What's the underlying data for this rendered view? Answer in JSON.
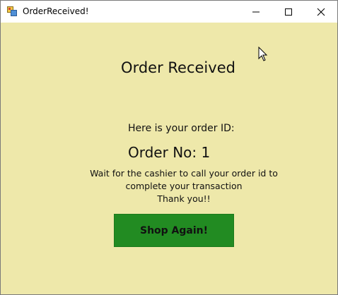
{
  "window": {
    "title": "OrderReceived!",
    "controls": {
      "minimize": "minimize-icon",
      "maximize": "maximize-icon",
      "close": "close-icon"
    }
  },
  "content": {
    "heading": "Order Received",
    "order_id_prompt": "Here is your order ID:",
    "order_label": "Order No:",
    "order_number": "1",
    "wait_line1": "Wait for the cashier to call your order id to",
    "wait_line2": "complete your transaction",
    "thanks": "Thank you!!",
    "shop_again_label": "Shop Again!"
  },
  "colors": {
    "background": "#eee8aa",
    "button": "#228b22"
  }
}
